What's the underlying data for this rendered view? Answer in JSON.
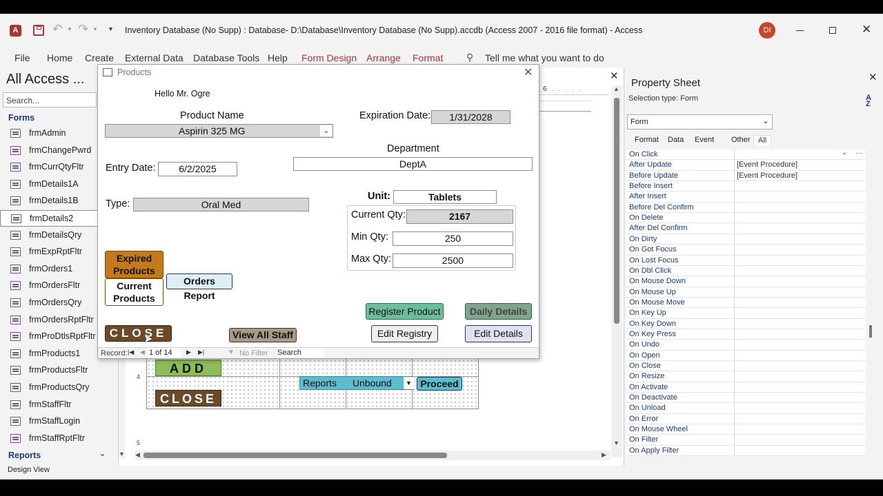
{
  "titlebar": {
    "title": "Inventory Database (No Supp) : Database- D:\\Database\\Inventory Database (No Supp).accdb (Access 2007 - 2016 file format)  -  Access",
    "avatar": "DI"
  },
  "ribbon": {
    "tabs": [
      "File",
      "Home",
      "Create",
      "External Data",
      "Database Tools",
      "Help"
    ],
    "context_tabs": [
      "Form Design",
      "Arrange",
      "Format"
    ],
    "tell_me": "Tell me what you want to do"
  },
  "nav": {
    "title": "All Access ...",
    "search_placeholder": "Search...",
    "section_forms": "Forms",
    "items": [
      "frmAdmin",
      "frmChangePwrd",
      "frmCurrQtyFltr",
      "frmDetails1A",
      "frmDetails1B",
      "frmDetails2",
      "frmDetailsQry",
      "frmExpRptFltr",
      "frmOrders1",
      "frmOrdersFltr",
      "frmOrdersQry",
      "frmOrdersRptFltr",
      "frmProDtlsRptFltr",
      "frmProducts1",
      "frmProductsFltr",
      "frmProductsQry",
      "frmStaffFltr",
      "frmStaffLogin",
      "frmStaffRptFltr"
    ],
    "selected": "frmDetails2",
    "section_reports": "Reports"
  },
  "design": {
    "ruler_label": "6",
    "add_label": "ADD",
    "close_label": "CLOSE",
    "reports_label": "Reports",
    "unbound_label": "Unbound",
    "proceed_label": "Proceed",
    "v_ruler_4": "4",
    "v_ruler_5": "5"
  },
  "products_form": {
    "title": "Products",
    "greeting": "Hello Mr. Ogre",
    "product_name_label": "Product Name",
    "product_name": "Aspirin 325 MG",
    "expiration_label": "Expiration Date:",
    "expiration": "1/31/2028",
    "department_label": "Department",
    "department": "DeptA",
    "entry_label": "Entry Date:",
    "entry_date": "6/2/2025",
    "type_label": "Type:",
    "type": "Oral Med",
    "unit_label": "Unit:",
    "unit": "Tablets",
    "current_qty_label": "Current Qty:",
    "current_qty": "2167",
    "min_qty_label": "Min Qty:",
    "min_qty": "250",
    "max_qty_label": "Max Qty:",
    "max_qty": "2500",
    "expired_btn_1": "Expired",
    "expired_btn_2": "Products",
    "current_btn_1": "Current",
    "current_btn_2": "Products",
    "orders_report_btn": "Orders Report",
    "register_btn": "Register Product",
    "daily_btn": "Daily  Details",
    "close_btn": "CLOSE",
    "view_staff_btn": "View All Staff",
    "edit_registry_btn": "Edit Registry",
    "edit_details_btn": "Edit Details",
    "record_label": "Record:",
    "record_pos": "1 of 14",
    "no_filter": "No Filter",
    "search": "Search"
  },
  "property_sheet": {
    "title": "Property Sheet",
    "selection_type": "Selection type:  Form",
    "combo_value": "Form",
    "tabs": [
      "Format",
      "Data",
      "Event",
      "Other",
      "All"
    ],
    "active_tab": "All",
    "rows": [
      {
        "name": "On Click",
        "value": ""
      },
      {
        "name": "After Update",
        "value": "[Event Procedure]"
      },
      {
        "name": "Before Update",
        "value": "[Event Procedure]"
      },
      {
        "name": "Before Insert",
        "value": ""
      },
      {
        "name": "After Insert",
        "value": ""
      },
      {
        "name": "Before Del Confirm",
        "value": ""
      },
      {
        "name": "On Delete",
        "value": ""
      },
      {
        "name": "After Del Confirm",
        "value": ""
      },
      {
        "name": "On Dirty",
        "value": ""
      },
      {
        "name": "On Got Focus",
        "value": ""
      },
      {
        "name": "On Lost Focus",
        "value": ""
      },
      {
        "name": "On Dbl Click",
        "value": ""
      },
      {
        "name": "On Mouse Down",
        "value": ""
      },
      {
        "name": "On Mouse Up",
        "value": ""
      },
      {
        "name": "On Mouse Move",
        "value": ""
      },
      {
        "name": "On Key Up",
        "value": ""
      },
      {
        "name": "On Key Down",
        "value": ""
      },
      {
        "name": "On Key Press",
        "value": ""
      },
      {
        "name": "On Undo",
        "value": ""
      },
      {
        "name": "On Open",
        "value": ""
      },
      {
        "name": "On Close",
        "value": ""
      },
      {
        "name": "On Resize",
        "value": ""
      },
      {
        "name": "On Activate",
        "value": ""
      },
      {
        "name": "On Deactivate",
        "value": ""
      },
      {
        "name": "On Unload",
        "value": ""
      },
      {
        "name": "On Error",
        "value": ""
      },
      {
        "name": "On Mouse Wheel",
        "value": ""
      },
      {
        "name": "On Filter",
        "value": ""
      },
      {
        "name": "On Apply Filter",
        "value": ""
      }
    ]
  },
  "status": {
    "view": "Design View"
  },
  "colors": {
    "access_red": "#a4373a",
    "expired_btn": "#c27a1b",
    "close_btn": "#6b4a2a",
    "add_btn": "#8fbc5a",
    "register_btn": "#6bbf9a",
    "daily_btn": "#7fa58f",
    "orders_btn": "#dceef7",
    "edit_details_btn": "#dde3f3",
    "reports_combo": "#5cbcd0"
  }
}
